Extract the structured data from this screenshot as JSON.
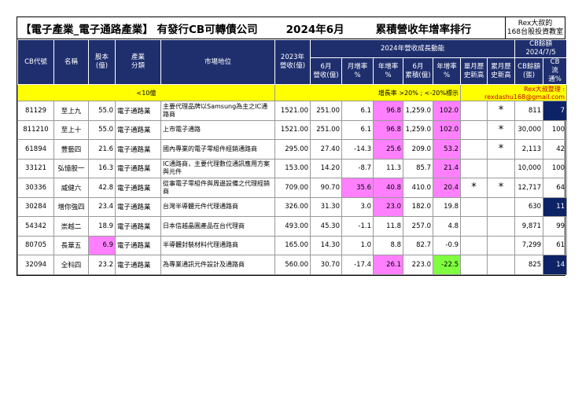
{
  "title": {
    "part1": "【電子產業_電子通路產業】 有發行CB可轉債公司",
    "part2": "2024年6月",
    "part3": "累積營收年增率排行"
  },
  "badge": {
    "line1": "Rex大叔的",
    "line2": "168台股投資教室"
  },
  "headers": {
    "code": "CB代號",
    "name": "名稱",
    "capital": "股本\n(億)",
    "industry": "產業\n分類",
    "market": "市場地位",
    "rev2023": "2023年\n營收(億)",
    "group": "2024年營收成長動能",
    "m6": "6月\n營收(億)",
    "mom": "月增率\n%",
    "yoy": "年增率\n%",
    "cum6": "6月\n累積(億)",
    "cumyoy": "年增率\n%",
    "monthhigh": "單月歷\n史新高",
    "cumhigh": "累月歷\n史新高",
    "cbgroup": "CB餘額\n2024/7/5",
    "cbbal": "CB餘額\n(張)",
    "cbflow": "CB\n流通%"
  },
  "notes": {
    "left": "<10億",
    "mid": "增長率 >20% ; <-20%標示",
    "right": "Rex大叔整理 : rexdashu168@gmail.com"
  },
  "rows": [
    {
      "code": "81129",
      "name": "至上九",
      "capital": "55.0",
      "industry": "電子通路業",
      "market": "主要代理品牌以Samsung為主之IC通路商",
      "rev2023": "1521.00",
      "m6": "251.00",
      "mom": "6.1",
      "yoy": "96.8",
      "cum6": "1,259.0",
      "cumyoy": "102.0",
      "monthhigh": "",
      "cumhigh": "*",
      "cbbal": "811",
      "cbflow": "7",
      "hl": {
        "capital": "",
        "yoy": "pink",
        "cumyoy": "pink",
        "cbflow": "navy"
      }
    },
    {
      "code": "811210",
      "name": "至上十",
      "capital": "55.0",
      "industry": "電子通路業",
      "market": "上市電子通路",
      "rev2023": "1521.00",
      "m6": "251.00",
      "mom": "6.1",
      "yoy": "96.8",
      "cum6": "1,259.0",
      "cumyoy": "102.0",
      "monthhigh": "",
      "cumhigh": "*",
      "cbbal": "30,000",
      "cbflow": "100",
      "hl": {
        "capital": "",
        "yoy": "pink",
        "cumyoy": "pink",
        "cbflow": ""
      }
    },
    {
      "code": "61894",
      "name": "豐藝四",
      "capital": "21.6",
      "industry": "電子通路業",
      "market": "國內專業的電子零組件經銷通路商",
      "rev2023": "295.00",
      "m6": "27.40",
      "mom": "-14.3",
      "yoy": "25.6",
      "cum6": "209.0",
      "cumyoy": "53.2",
      "monthhigh": "",
      "cumhigh": "*",
      "cbbal": "2,113",
      "cbflow": "42",
      "hl": {
        "capital": "",
        "yoy": "pink",
        "cumyoy": "pink",
        "cbflow": ""
      }
    },
    {
      "code": "33121",
      "name": "弘憶股一",
      "capital": "16.3",
      "industry": "電子通路業",
      "market": "IC通路商，主要代理數位通訊應用方案與元件",
      "rev2023": "153.00",
      "m6": "14.20",
      "mom": "-8.7",
      "yoy": "11.3",
      "cum6": "85.7",
      "cumyoy": "21.4",
      "monthhigh": "",
      "cumhigh": "",
      "cbbal": "10,000",
      "cbflow": "100",
      "hl": {
        "capital": "",
        "yoy": "",
        "cumyoy": "pink",
        "cbflow": ""
      }
    },
    {
      "code": "30336",
      "name": "威健六",
      "capital": "42.8",
      "industry": "電子通路業",
      "market": "從事電子零組件與周邊設備之代理經銷商",
      "rev2023": "709.00",
      "m6": "90.70",
      "mom": "35.6",
      "yoy": "40.8",
      "cum6": "410.0",
      "cumyoy": "20.4",
      "monthhigh": "*",
      "cumhigh": "*",
      "cbbal": "12,717",
      "cbflow": "64",
      "hl": {
        "capital": "",
        "mom": "pink",
        "yoy": "pink",
        "cumyoy": "pink",
        "cbflow": ""
      }
    },
    {
      "code": "30284",
      "name": "增你強四",
      "capital": "23.4",
      "industry": "電子通路業",
      "market": "台灣半導體元件代理通路商",
      "rev2023": "326.00",
      "m6": "31.30",
      "mom": "3.0",
      "yoy": "23.0",
      "cum6": "182.0",
      "cumyoy": "19.8",
      "monthhigh": "",
      "cumhigh": "",
      "cbbal": "630",
      "cbflow": "11",
      "hl": {
        "capital": "",
        "yoy": "pink",
        "cumyoy": "",
        "cbflow": "navy"
      }
    },
    {
      "code": "54342",
      "name": "崇越二",
      "capital": "18.9",
      "industry": "電子通路業",
      "market": "日本信越晶圓產品在台代理商",
      "rev2023": "493.00",
      "m6": "45.30",
      "mom": "-1.1",
      "yoy": "11.8",
      "cum6": "257.0",
      "cumyoy": "4.8",
      "monthhigh": "",
      "cumhigh": "",
      "cbbal": "9,871",
      "cbflow": "99",
      "hl": {
        "capital": "",
        "yoy": "",
        "cumyoy": "",
        "cbflow": ""
      }
    },
    {
      "code": "80705",
      "name": "長華五",
      "capital": "6.9",
      "industry": "電子通路業",
      "market": "半導體封裝材料代理通路商",
      "rev2023": "165.00",
      "m6": "14.30",
      "mom": "1.0",
      "yoy": "8.8",
      "cum6": "82.7",
      "cumyoy": "-0.9",
      "monthhigh": "",
      "cumhigh": "",
      "cbbal": "7,299",
      "cbflow": "61",
      "hl": {
        "capital": "pink",
        "yoy": "",
        "cumyoy": "",
        "cbflow": ""
      }
    },
    {
      "code": "32094",
      "name": "全科四",
      "capital": "23.2",
      "industry": "電子通路業",
      "market": "為專業通訊元件設計及通路商",
      "rev2023": "560.00",
      "m6": "30.70",
      "mom": "-17.4",
      "yoy": "26.1",
      "cum6": "223.0",
      "cumyoy": "-22.5",
      "monthhigh": "",
      "cumhigh": "",
      "cbbal": "825",
      "cbflow": "14",
      "hl": {
        "capital": "",
        "yoy": "pink",
        "cumyoy": "green",
        "cbflow": "navy"
      }
    }
  ]
}
